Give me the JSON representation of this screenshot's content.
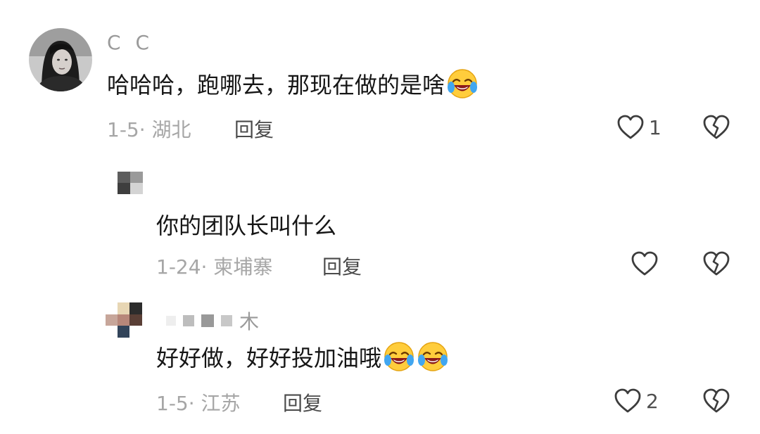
{
  "comments": [
    {
      "username": "C C",
      "text": "哈哈哈，跑哪去，那现在做的是啥",
      "date": "1-5",
      "location": "湖北",
      "reply_label": "回复",
      "like_count": "1",
      "emoji": "laughing-crying-emoji"
    },
    {
      "username": "",
      "text": "你的团队长叫什么",
      "date": "1-24",
      "location": "柬埔寨",
      "reply_label": "回复",
      "like_count": ""
    },
    {
      "username": "木",
      "text": "好好做，好好投加油哦",
      "date": "1-5",
      "location": "江苏",
      "reply_label": "回复",
      "like_count": "2",
      "emoji": "laughing-crying-emoji"
    }
  ],
  "colors": {
    "text": "#161616",
    "meta": "#a6a6a6",
    "icon": "#3c3c3c"
  },
  "icons": {
    "like": "heart-outline-icon",
    "dislike": "broken-heart-icon"
  }
}
